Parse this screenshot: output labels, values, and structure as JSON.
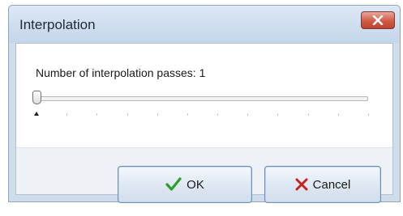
{
  "dialog": {
    "title": "Interpolation",
    "close_icon": "close-x-icon",
    "passes_label": "Number of interpolation passes:",
    "passes_value": "1",
    "slider": {
      "value_fraction": 0,
      "tick_count": 12
    },
    "ok": {
      "icon": "checkmark-icon",
      "label": "OK"
    },
    "cancel": {
      "icon": "cross-icon",
      "label": "Cancel"
    }
  },
  "colors": {
    "ok_check": "#2e9e2a",
    "cancel_cross": "#c8231b",
    "close_button": "#cf5a45"
  }
}
